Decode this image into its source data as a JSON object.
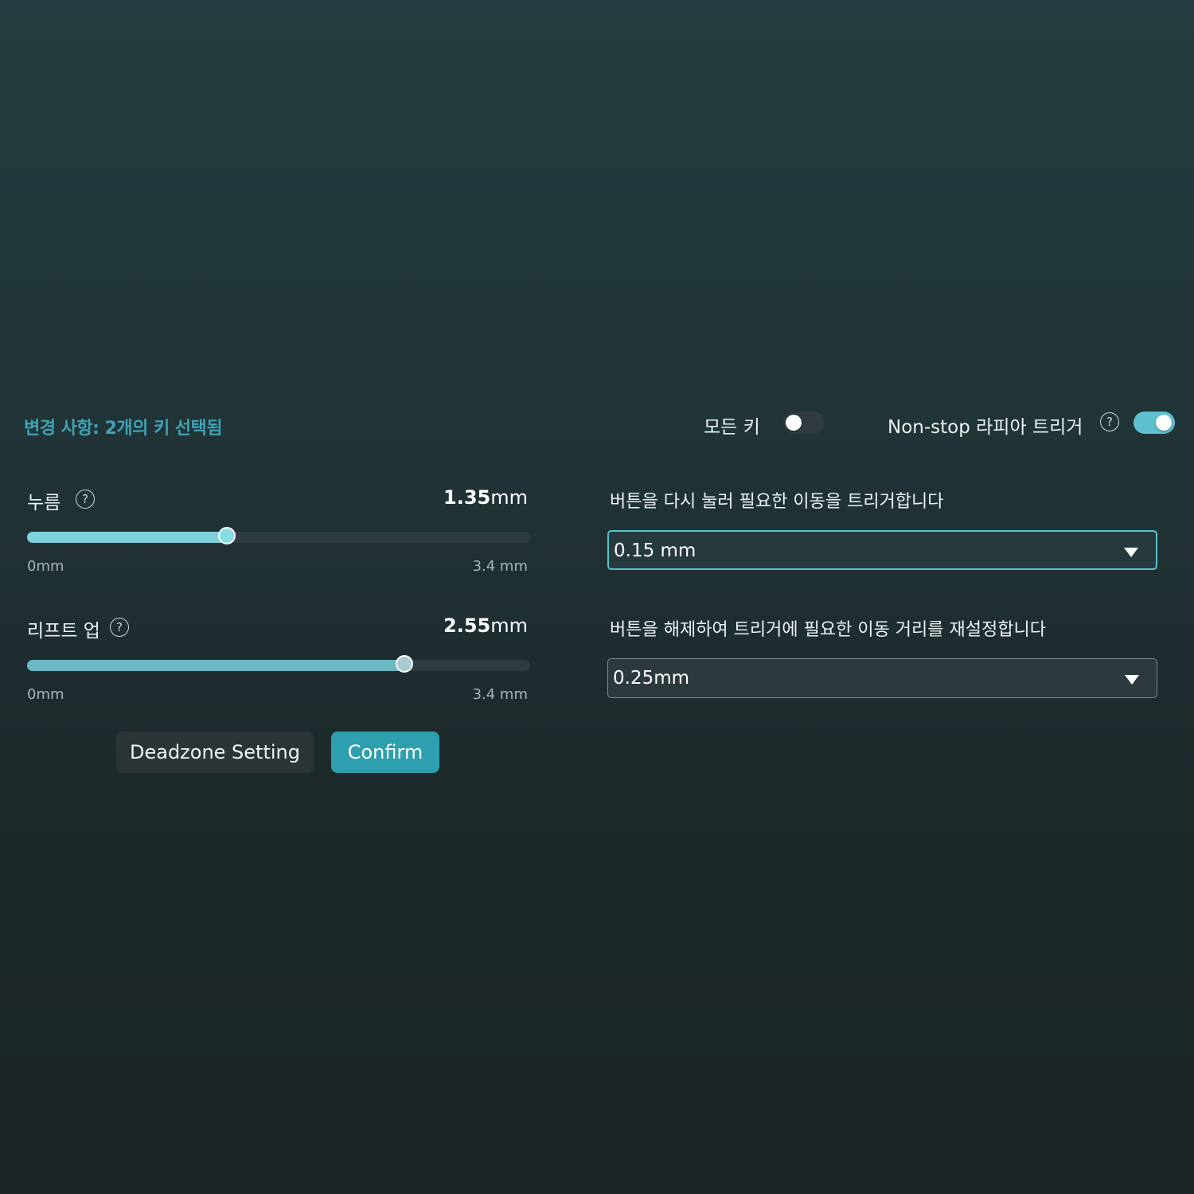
{
  "header": {
    "status_text": "변경 사항: 2개의 키 선택됨",
    "all_keys": {
      "label": "모든 키",
      "enabled": false
    },
    "nonstop": {
      "label": "Non-stop 라피아 트리거",
      "help": "?",
      "enabled": true
    }
  },
  "press": {
    "label": "누름",
    "help": "?",
    "value_number": "1.35",
    "value_unit": "mm",
    "value": 1.35,
    "max": 3.4,
    "min_label": "0mm",
    "max_label": "3.4 mm",
    "fill_color": "#7fd2dc",
    "thumb_color": "#86dbe5"
  },
  "liftup": {
    "label": "리프트 업",
    "help": "?",
    "value_number": "2.55",
    "value_unit": "mm",
    "value": 2.55,
    "max": 3.4,
    "min_label": "0mm",
    "max_label": "3.4 mm",
    "fill_color": "#6bb8c2",
    "thumb_color": "#a9ccd1"
  },
  "buttons": {
    "deadzone": "Deadzone Setting",
    "confirm": "Confirm"
  },
  "retrigger": {
    "description": "버튼을 다시 눌러 필요한 이동을 트리거합니다",
    "value": "0.15 mm"
  },
  "reset": {
    "description": "버튼을 해제하여 트리거에 필요한 이동 거리를 재설정합니다",
    "value": "0.25mm"
  },
  "colors": {
    "accent": "#3fa3b5",
    "toggle_on": "#5fc1cf",
    "confirm_bg": "#2e9faf"
  }
}
